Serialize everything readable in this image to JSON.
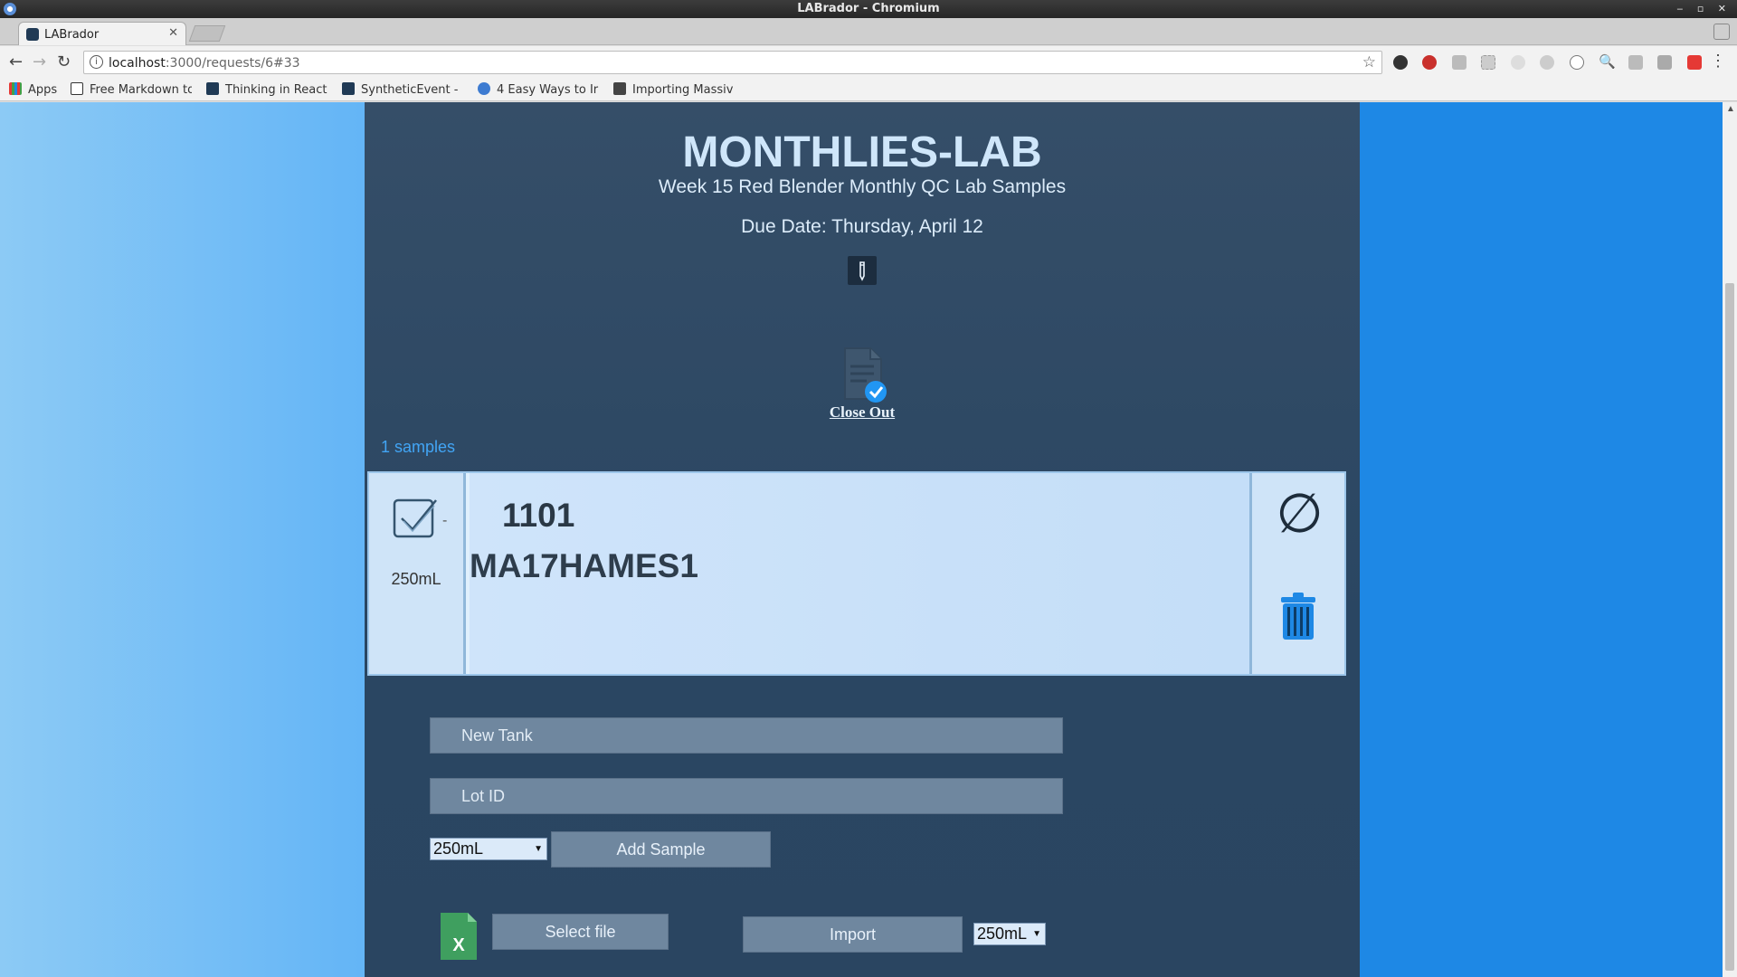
{
  "window": {
    "title": "LABrador - Chromium"
  },
  "browser": {
    "tab_title": "LABrador",
    "url_host": "localhost",
    "url_path": ":3000/requests/6#33",
    "bookmarks": [
      "Apps",
      "Free Markdown to",
      "Thinking in React",
      "SyntheticEvent -",
      "4 Easy Ways to Ir",
      "Importing Massiv"
    ]
  },
  "lab": {
    "title": "MONTHLIES-LAB",
    "subtitle": "Week 15 Red Blender Monthly QC Lab Samples",
    "due_date": "Due Date: Thursday, April 12",
    "close_out": "Close Out",
    "sample_count": "1 samples"
  },
  "sample": {
    "dash": "-",
    "volume": "250mL",
    "tank": "1101",
    "lot_id": "MA17HAMES1"
  },
  "form": {
    "tank_placeholder": "New Tank",
    "lot_placeholder": "Lot ID",
    "volume_selected": "250mL",
    "add_sample": "Add Sample",
    "select_file": "Select file",
    "import": "Import",
    "import_volume_selected": "250mL"
  },
  "colors": {
    "panel": "#2a4662",
    "accent": "#1e88e5",
    "link": "#42a5f5",
    "card": "#cfe4f8"
  }
}
